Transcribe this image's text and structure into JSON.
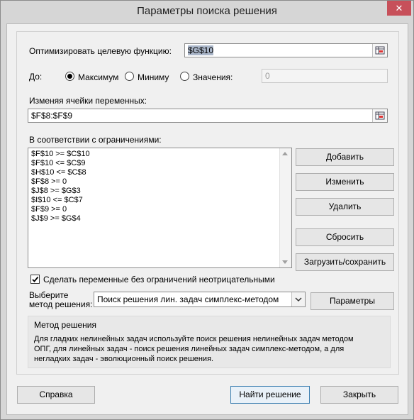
{
  "window": {
    "title": "Параметры поиска решения",
    "close_symbol": "✕"
  },
  "objective": {
    "label": "Оптимизировать целевую функцию:",
    "value": "$G$10"
  },
  "to": {
    "label": "До:",
    "max_label": "Максимум",
    "min_label": "Миниму",
    "value_label": "Значения:",
    "value_field": "0",
    "selected": "max"
  },
  "changing": {
    "label": "Изменяя ячейки переменных:",
    "value": "$F$8:$F$9"
  },
  "constraints": {
    "label": "В соответствии с ограничениями:",
    "items": [
      "$F$10 >= $C$10",
      "$F$10 <= $C$9",
      "$H$10 <= $C$8",
      "$F$8 >= 0",
      "$J$8 >= $G$3",
      "$I$10 <= $C$7",
      "$F$9 >= 0",
      "$J$9 >= $G$4"
    ]
  },
  "buttons": {
    "add": "Добавить",
    "change": "Изменить",
    "delete": "Удалить",
    "reset": "Сбросить",
    "load_save": "Загрузить/сохранить",
    "options": "Параметры",
    "help": "Справка",
    "solve": "Найти решение",
    "close": "Закрыть"
  },
  "nonneg": {
    "label": "Сделать переменные без ограничений неотрицательными",
    "checked": true
  },
  "method": {
    "label_line1": "Выберите",
    "label_line2": "метод решения:",
    "selected": "Поиск решения лин. задач симплекс-методом"
  },
  "method_group": {
    "title": "Метод решения",
    "line1": "Для гладких нелинейных задач используйте поиск решения нелинейных задач методом",
    "line2": "ОПГ, для линейных задач - поиск решения линейных задач симплекс-методом, а для",
    "line3": "негладких задач - эволюционный поиск решения."
  },
  "icons": {
    "ref_select": "range-select-icon",
    "dropdown": "chevron-down-icon",
    "check": "checkmark-icon"
  }
}
